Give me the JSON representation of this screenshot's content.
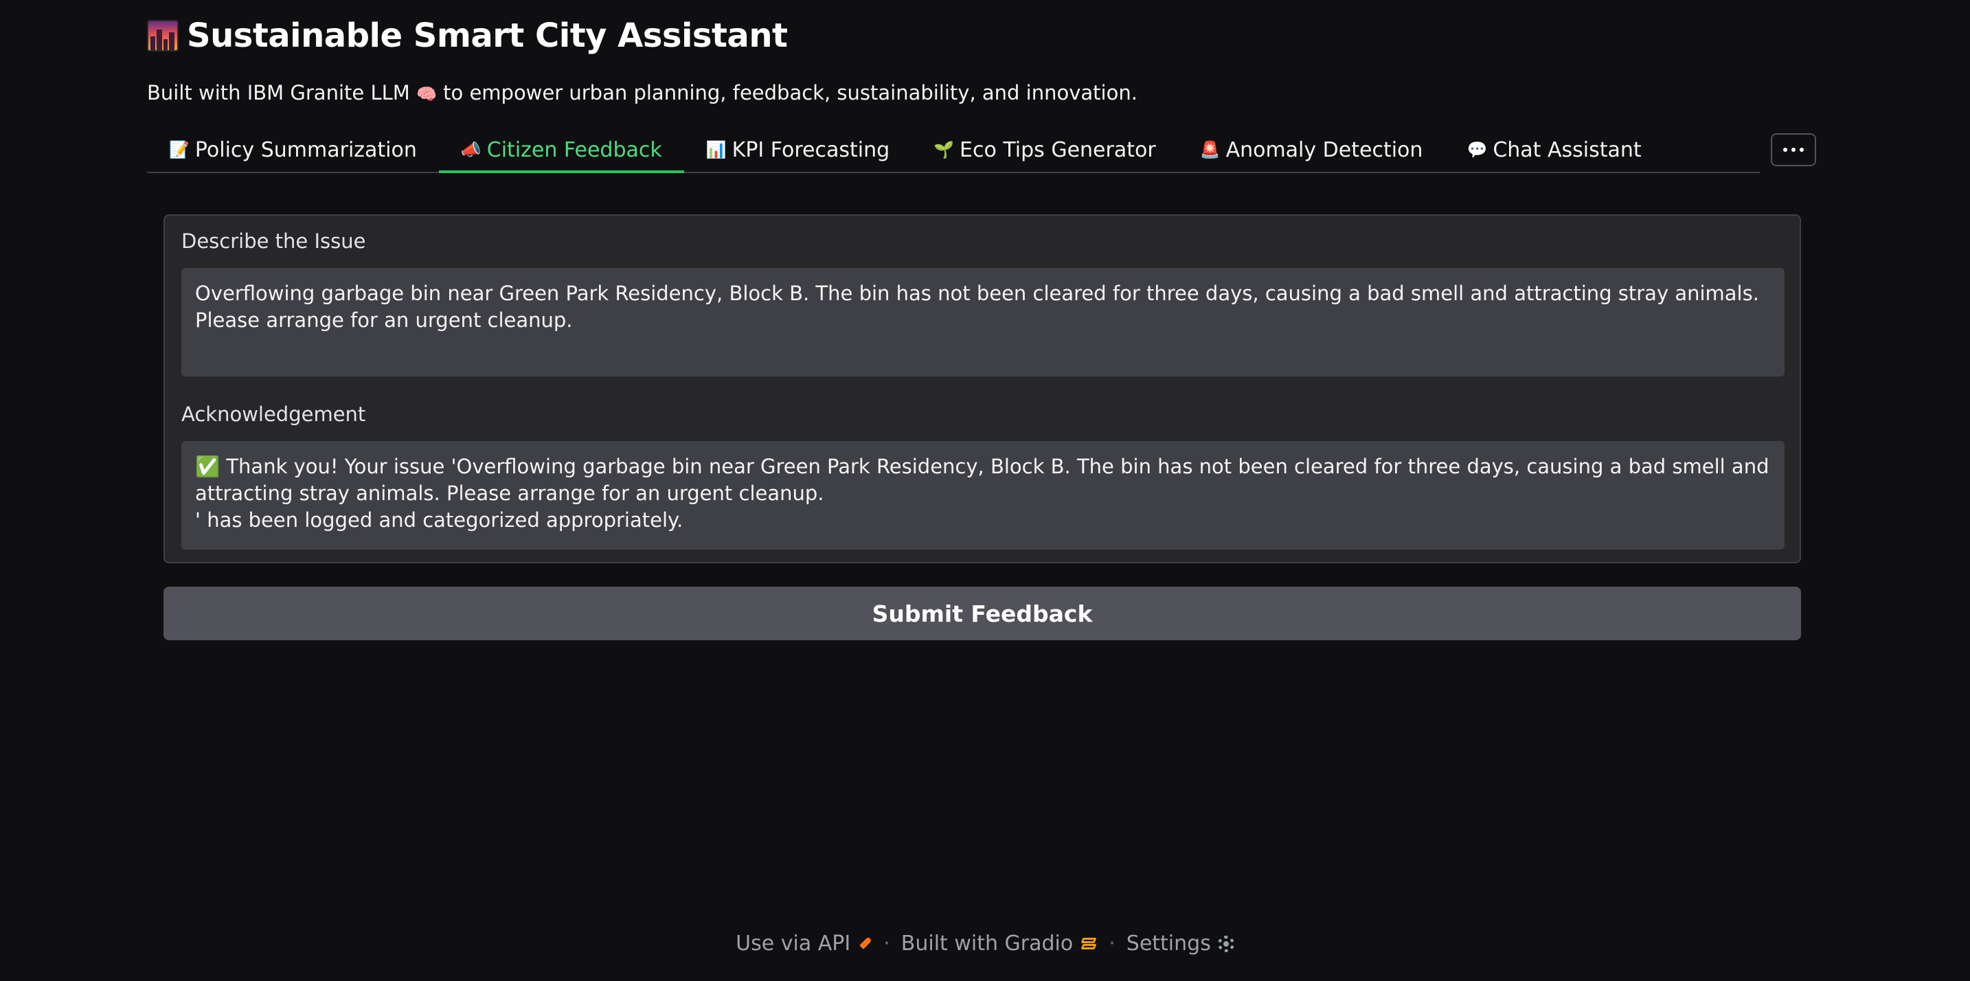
{
  "header": {
    "title": "Sustainable Smart City Assistant",
    "title_icon": "city-sunset-icon",
    "subtitle_prefix": "Built with IBM Granite LLM",
    "subtitle_icon": "🧠",
    "subtitle_suffix": "to empower urban planning, feedback, sustainability, and innovation."
  },
  "tabs": [
    {
      "icon": "📝",
      "label": "Policy Summarization"
    },
    {
      "icon": "📣",
      "label": "Citizen Feedback",
      "active": true
    },
    {
      "icon": "📊",
      "label": "KPI Forecasting"
    },
    {
      "icon": "🌱",
      "label": "Eco Tips Generator"
    },
    {
      "icon": "🚨",
      "label": "Anomaly Detection"
    },
    {
      "icon": "💬",
      "label": "Chat Assistant"
    }
  ],
  "form": {
    "issue_label": "Describe the Issue",
    "issue_value": "Overflowing garbage bin near Green Park Residency, Block B. The bin has not been cleared for three days, causing a bad smell and attracting stray animals. Please arrange for an urgent cleanup.",
    "ack_label": "Acknowledgement",
    "ack_value": "✅ Thank you! Your issue 'Overflowing garbage bin near Green Park Residency, Block B. The bin has not been cleared for three days, causing a bad smell and attracting stray animals. Please arrange for an urgent cleanup.\n' has been logged and categorized appropriately.",
    "submit_label": "Submit Feedback"
  },
  "footer": {
    "api_label": "Use via API",
    "gradio_label": "Built with Gradio",
    "settings_label": "Settings",
    "separator": "·"
  },
  "colors": {
    "background": "#0f0f11",
    "panel": "#27272a",
    "textbox": "#3f3f46",
    "accent": "#22c55e",
    "button": "#52525b"
  }
}
